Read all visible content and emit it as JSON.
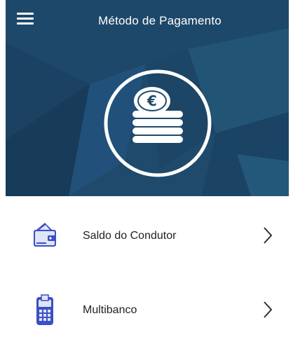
{
  "header": {
    "title": "Método de Pagamento",
    "menu_icon": "hamburger-menu-icon",
    "background_color": "#1e4a6c"
  },
  "hero": {
    "emblem_icon": "euro-coins-icon"
  },
  "payment_methods": [
    {
      "label": "Saldo do Condutor",
      "icon": "wallet-icon",
      "accent": "#3b4fc8"
    },
    {
      "label": "Multibanco",
      "icon": "atm-card-terminal-icon",
      "accent": "#3b4fc8"
    }
  ],
  "chevron_icon": "chevron-right-icon"
}
